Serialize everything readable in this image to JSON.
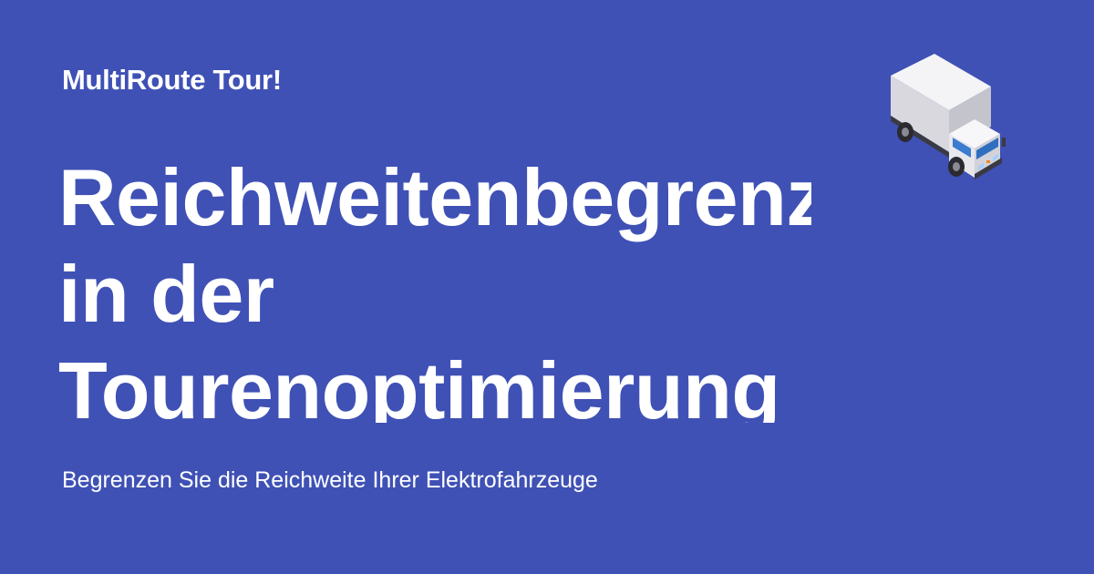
{
  "brand": {
    "name": "MultiRoute Tour!"
  },
  "headline": {
    "line1": "Reichweitenbegrenzung",
    "line2": "in der",
    "line3": "Tourenoptimierung"
  },
  "subtitle": "Begrenzen Sie die Reichweite Ihrer Elektrofahrzeuge",
  "colors": {
    "background": "#3f51b5",
    "text": "#ffffff",
    "truck_body": "#e9e9ee",
    "truck_cab_window": "#2f6fbf"
  },
  "icons": {
    "truck": "delivery-truck-icon"
  }
}
